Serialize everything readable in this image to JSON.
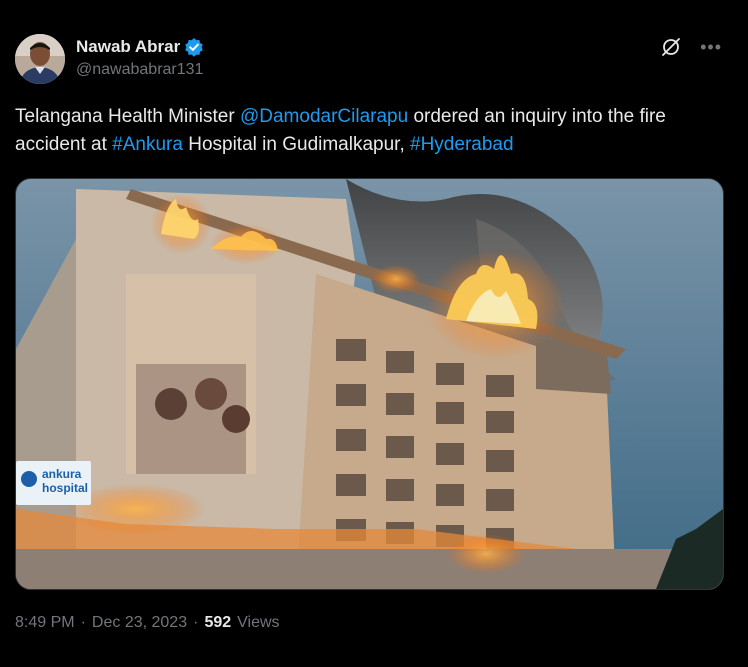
{
  "author": {
    "display_name": "Nawab Abrar",
    "handle": "@nawababrar131"
  },
  "icons": {
    "verified": "verified-badge-icon",
    "grok": "grok-slash-icon",
    "more": "more-horizontal-icon"
  },
  "tweet": {
    "text_before_mention": "Telangana Health Minister ",
    "mention": "@DamodarCilarapu",
    "text_after_mention": " ordered an inquiry into the fire accident at ",
    "hashtag_1": "#Ankura",
    "text_middle": " Hospital in Gudimalkapur, ",
    "hashtag_2": "#Hyderabad"
  },
  "media": {
    "sign_line1": "ankura",
    "sign_line2": "hospital"
  },
  "meta": {
    "time": "8:49 PM",
    "separator": "·",
    "date": "Dec 23, 2023",
    "separator2": "·",
    "views_count": "592",
    "views_label": "Views"
  },
  "colors": {
    "background": "#000000",
    "text": "#e7e9ea",
    "secondary": "#71767b",
    "link": "#1d9bf0",
    "verified": "#1d9bf0"
  }
}
